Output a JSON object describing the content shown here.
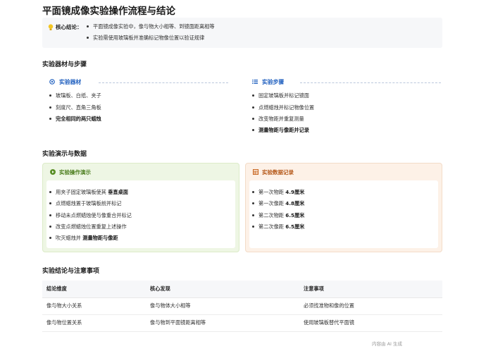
{
  "title": "平面镜成像实验操作流程与结论",
  "core_conclusion": {
    "label": "核心结论：",
    "items": [
      "平面镜成像实验中，像与物大小相等、到镜面距离相等",
      "实验需使用玻璃板并准确标记物像位置以验证规律"
    ]
  },
  "section_materials_steps": {
    "title": "实验器材与步骤",
    "materials": {
      "heading": "实验器材",
      "items": [
        "玻璃板、白纸、夹子",
        "刻度尺、直角三角板"
      ],
      "bold_item": "完全相同的两只蜡烛"
    },
    "steps": {
      "heading": "实验步骤",
      "items": [
        "固定玻璃板并标记镜面",
        "点燃蜡烛并标记物像位置",
        "改变物距并重复测量"
      ],
      "bold_item": "测量物距与像距并记录"
    }
  },
  "section_demo_data": {
    "title": "实验演示与数据",
    "demo": {
      "heading": "实验操作演示",
      "items": [
        {
          "text": "用夹子固定玻璃板使其",
          "bold": "垂直桌面"
        },
        {
          "text": "点燃蜡烛置于玻璃板前并标记",
          "bold": ""
        },
        {
          "text": "移动未点燃蜡烛使与像重合并标记",
          "bold": ""
        },
        {
          "text": "改变点燃蜡烛位置重复上述操作",
          "bold": ""
        },
        {
          "text": "吹灭蜡烛并",
          "bold": "测量物距与像距"
        }
      ]
    },
    "records": {
      "heading": "实验数据记录",
      "items": [
        {
          "label": "第一次物距",
          "value": "4.9厘米"
        },
        {
          "label": "第一次像距",
          "value": "4.8厘米"
        },
        {
          "label": "第二次物距",
          "value": "6.5厘米"
        },
        {
          "label": "第二次像距",
          "value": "6.5厘米"
        }
      ]
    }
  },
  "section_table": {
    "title": "实验结论与注意事项",
    "headers": [
      "结论维度",
      "核心发现",
      "注意事项"
    ],
    "rows": [
      [
        "像与物大小关系",
        "像与物体大小相等",
        "必须找准物和像的位置"
      ],
      [
        "像与物位置关系",
        "像与物到平面镜距离相等",
        "使用玻璃板替代平面镜"
      ]
    ]
  },
  "footer_note": "内容由 AI 生成",
  "colors": {
    "blue_accent": "#1f5fbf",
    "green_accent": "#4b7d1d",
    "orange_accent": "#b5591a",
    "green_card_bg": "#eef6e4",
    "orange_card_bg": "#fdf1e7"
  },
  "icons": {
    "conclusion": "lightbulb-icon",
    "materials": "target-icon",
    "steps": "list-icon",
    "demo": "play-icon",
    "records": "table-icon"
  }
}
